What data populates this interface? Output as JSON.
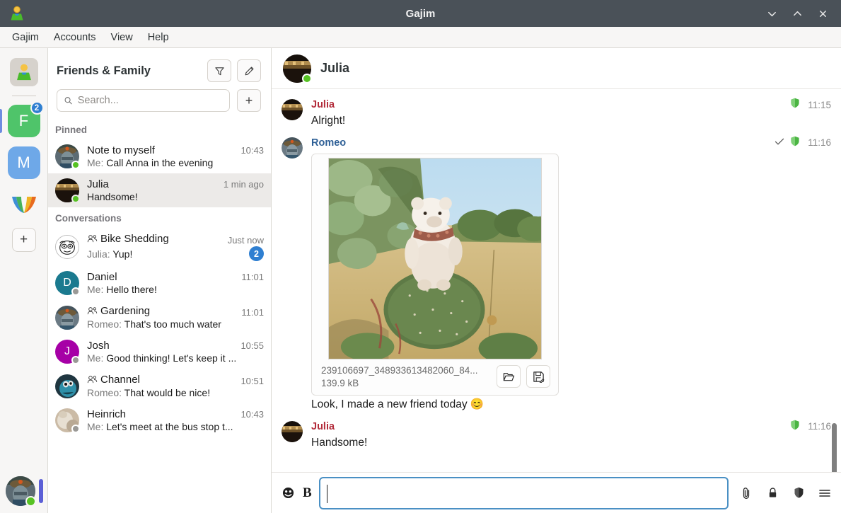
{
  "window": {
    "title": "Gajim",
    "app_icon": "gajim-user-icon",
    "controls": [
      {
        "name": "minimize-button",
        "icon": "chevron-down-icon"
      },
      {
        "name": "maximize-button",
        "icon": "chevron-up-icon"
      },
      {
        "name": "close-button",
        "icon": "close-icon"
      }
    ]
  },
  "menubar": {
    "items": [
      {
        "label": "Gajim"
      },
      {
        "label": "Accounts"
      },
      {
        "label": "View"
      },
      {
        "label": "Help"
      }
    ]
  },
  "rail": {
    "app_avatar_icon": "gajim-user-icon",
    "accounts": [
      {
        "label": "F",
        "color": "#4fc46a",
        "badge": "2",
        "active": true
      },
      {
        "label": "M",
        "color": "#6ea8e8",
        "badge": "",
        "active": false
      }
    ],
    "extra_icon": "feather-logo-icon",
    "add_account_label": "+",
    "self_status": "online"
  },
  "sidebar": {
    "title": "Friends & Family",
    "filter_icon": "filter-icon",
    "compose_icon": "pencil-icon",
    "search": {
      "placeholder": "Search...",
      "value": "",
      "icon": "search-icon"
    },
    "add_label": "+",
    "groups": [
      {
        "label": "Pinned",
        "rows": [
          {
            "name": "Note to myself",
            "time": "10:43",
            "preview_who": "Me:",
            "preview_text": "Call Anna in the evening",
            "status": "online",
            "is_group": false,
            "selected": false,
            "unread": "",
            "avatar": "photo-helmet",
            "avatar_color": "#4a5f6e"
          },
          {
            "name": "Julia",
            "time": "1 min ago",
            "preview_who": "",
            "preview_text": "Handsome!",
            "status": "online",
            "is_group": false,
            "selected": true,
            "unread": "",
            "avatar": "photo-julia",
            "avatar_color": "#2a1d14"
          }
        ]
      },
      {
        "label": "Conversations",
        "rows": [
          {
            "name": "Bike Shedding",
            "time": "Just now",
            "preview_who": "Julia:",
            "preview_text": "Yup!",
            "status": "",
            "is_group": true,
            "selected": false,
            "unread": "2",
            "avatar": "doodle-face",
            "avatar_color": "#ffffff"
          },
          {
            "name": "Daniel",
            "time": "11:01",
            "preview_who": "Me:",
            "preview_text": "Hello there!",
            "status": "offline",
            "is_group": false,
            "selected": false,
            "unread": "",
            "avatar": "letter-D",
            "avatar_color": "#1b7a8f"
          },
          {
            "name": "Gardening",
            "time": "11:01",
            "preview_who": "Romeo:",
            "preview_text": "That's too much water",
            "status": "",
            "is_group": true,
            "selected": false,
            "unread": "",
            "avatar": "photo-helmet",
            "avatar_color": "#53606b"
          },
          {
            "name": "Josh",
            "time": "10:55",
            "preview_who": "Me:",
            "preview_text": "Good thinking! Let's keep it ...",
            "status": "offline",
            "is_group": false,
            "selected": false,
            "unread": "",
            "avatar": "letter-J",
            "avatar_color": "#a600a6"
          },
          {
            "name": "Channel",
            "time": "10:51",
            "preview_who": "Romeo:",
            "preview_text": "That would be nice!",
            "status": "",
            "is_group": true,
            "selected": false,
            "unread": "",
            "avatar": "photo-monster",
            "avatar_color": "#27414d"
          },
          {
            "name": "Heinrich",
            "time": "10:43",
            "preview_who": "Me:",
            "preview_text": "Let's meet at the bus stop t...",
            "status": "offline",
            "is_group": false,
            "selected": false,
            "unread": "",
            "avatar": "photo-pale",
            "avatar_color": "#b8aa9a"
          }
        ]
      }
    ]
  },
  "chat": {
    "header": {
      "name": "Julia",
      "status": "online"
    },
    "messages": [
      {
        "author": "Julia",
        "author_style": "julia",
        "time": "11:15",
        "text": "Alright!",
        "encrypted": true,
        "receipt": false,
        "attachment": null
      },
      {
        "author": "Romeo",
        "author_style": "romeo",
        "time": "11:16",
        "text": "Look, I made a new friend today 😊",
        "encrypted": true,
        "receipt": true,
        "attachment": {
          "file_name": "239106697_348933613482060_84...",
          "file_size": "139.9 kB",
          "open_folder_icon": "folder-open-icon",
          "save_as_icon": "save-as-icon",
          "image_alt": "white plush bear sitting on a prickly pear cactus in dry grassland"
        }
      },
      {
        "author": "Julia",
        "author_style": "julia",
        "time": "11:16",
        "text": "Handsome!",
        "encrypted": true,
        "receipt": false,
        "attachment": null
      }
    ],
    "encryption_icon": "shield-icon",
    "receipt_icon": "check-icon"
  },
  "composer": {
    "emoji_icon": "emoji-smiley-icon",
    "bold_label": "B",
    "input_value": "",
    "input_placeholder": "",
    "attach_icon": "paperclip-icon",
    "encryption_icon": "lock-icon",
    "security_icon": "shield-icon",
    "menu_icon": "hamburger-menu-icon"
  }
}
